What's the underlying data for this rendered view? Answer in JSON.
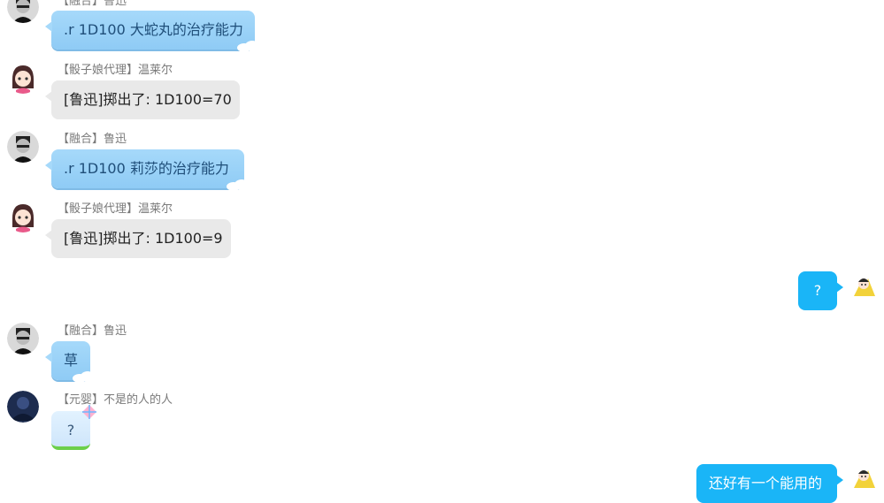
{
  "messages": [
    {
      "tag": "【融合】",
      "name": "鲁迅",
      "text": ".r 1D100 大蛇丸的治疗能力"
    },
    {
      "tag": "【骰子娘代理】",
      "name": "温莱尔",
      "text": "[鲁迅]掷出了: 1D100=70"
    },
    {
      "tag": "【融合】",
      "name": "鲁迅",
      "text": ".r 1D100 莉莎的治疗能力"
    },
    {
      "tag": "【骰子娘代理】",
      "name": "温莱尔",
      "text": "[鲁迅]掷出了: 1D100=9"
    },
    {
      "text": "?"
    },
    {
      "tag": "【融合】",
      "name": "鲁迅",
      "text": "草"
    },
    {
      "tag": "【元婴】",
      "name": "不是的人的人",
      "text": "?"
    },
    {
      "text": "还好有一个能用的"
    }
  ],
  "colors": {
    "blue_bubble": "#9ad2f8",
    "gray_bubble": "#e9e9e9",
    "self_bubble": "#1ab5f7"
  }
}
